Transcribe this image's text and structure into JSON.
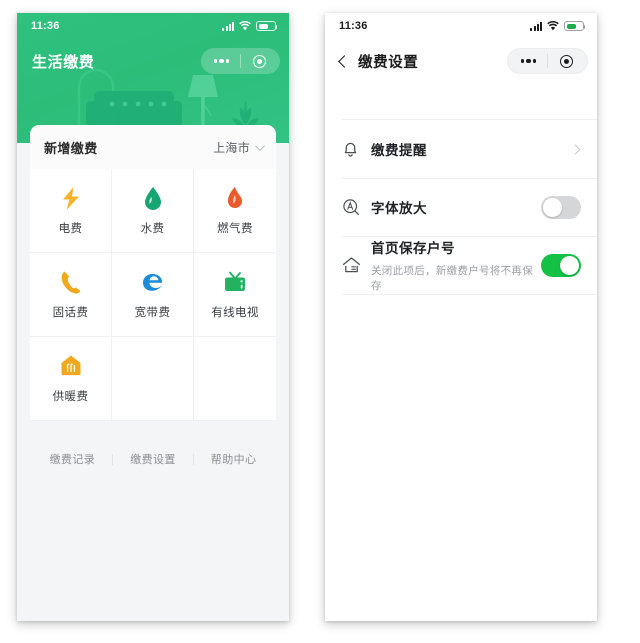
{
  "theme": {
    "brand_green": "#2cbd79",
    "toggle_on_green": "#13c244",
    "page_background": "#ffffff",
    "card_background": "#ffffff"
  },
  "left_screen": {
    "status_bar": {
      "time": "11:36",
      "icons": [
        "signal-bars-icon",
        "wifi-icon",
        "battery-icon"
      ],
      "battery_level": "60"
    },
    "capsule": {
      "more_label": "more-dots-icon",
      "close_label": "target-circle-icon"
    },
    "hero": {
      "title": "生活缴费",
      "illustration": [
        "door-arch",
        "sofa",
        "floor-lamp",
        "plant"
      ]
    },
    "card": {
      "title": "新增缴费",
      "city_selector": {
        "value": "上海市",
        "icon": "chevron-down-icon"
      },
      "services": [
        {
          "label": "电费",
          "icon": "lightning-bolt-icon",
          "color": "#f7b32b"
        },
        {
          "label": "水费",
          "icon": "water-drop-icon",
          "color": "#17a673"
        },
        {
          "label": "燃气费",
          "icon": "flame-icon",
          "color": "#e8592c"
        },
        {
          "label": "固话费",
          "icon": "telephone-icon",
          "color": "#f0a81e"
        },
        {
          "label": "宽带费",
          "icon": "edge-browser-icon",
          "color": "#1a8cd8"
        },
        {
          "label": "有线电视",
          "icon": "television-icon",
          "color": "#23b360"
        },
        {
          "label": "供暖费",
          "icon": "heating-house-icon",
          "color": "#f0a81e"
        }
      ],
      "footer_links": [
        "缴费记录",
        "缴费设置",
        "帮助中心"
      ]
    }
  },
  "right_screen": {
    "status_bar": {
      "time": "11:36",
      "icons": [
        "signal-bars-icon",
        "wifi-icon",
        "battery-icon"
      ],
      "battery_level": "60"
    },
    "capsule": {
      "more_label": "more-dots-icon",
      "close_label": "target-circle-icon"
    },
    "navbar": {
      "back_icon": "chevron-left-icon",
      "title": "缴费设置"
    },
    "settings_rows": [
      {
        "label": "缴费提醒",
        "sub": "",
        "icon": "bell-icon",
        "control": "chevron-right"
      },
      {
        "label": "字体放大",
        "sub": "",
        "icon": "font-size-icon",
        "control": "toggle-off"
      },
      {
        "label": "首页保存户号",
        "sub": "关闭此项后，新缴费户号将不再保存",
        "icon": "home-icon",
        "control": "toggle-on"
      }
    ]
  }
}
